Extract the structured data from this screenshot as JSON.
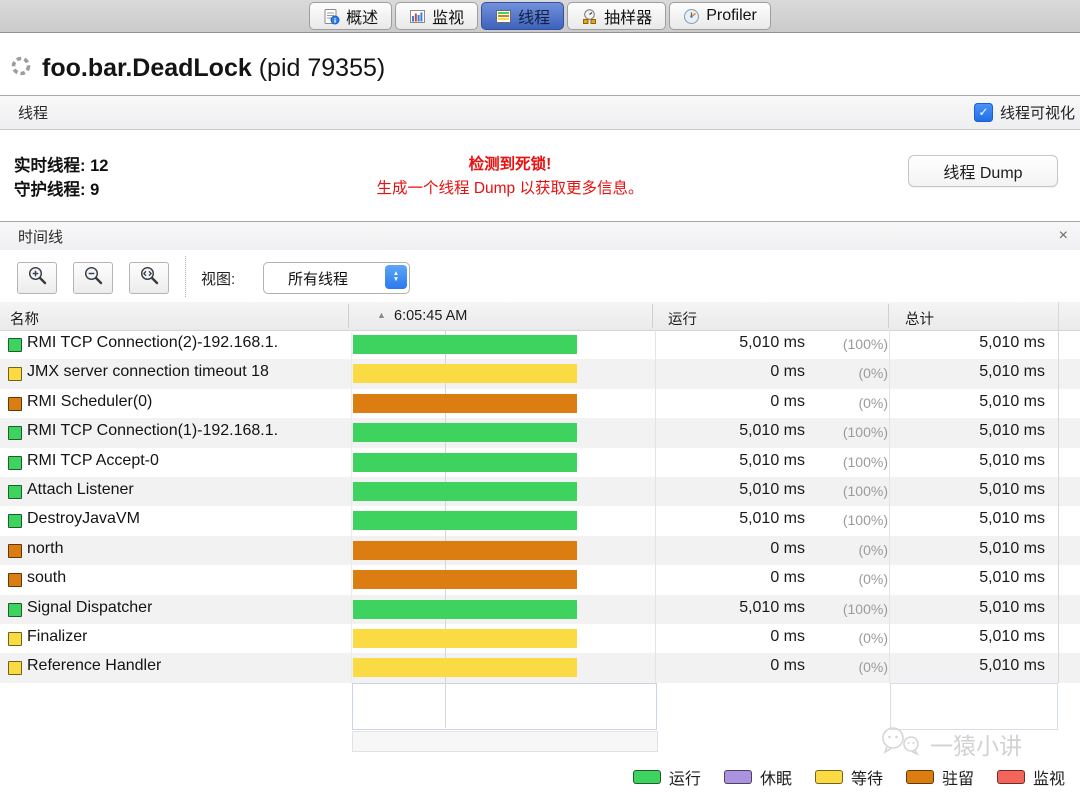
{
  "colors": {
    "running": "#3dd35e",
    "waiting": "#fadb44",
    "parked": "#dc7d12",
    "sleeping": "#ac93df",
    "monitor": "#f3655a",
    "accent_blue": "#2e7ef0",
    "warning_red": "#ea1010",
    "selected_tab_blue": "#4a70c8"
  },
  "tabs": [
    {
      "label": "概述"
    },
    {
      "label": "监视"
    },
    {
      "label": "线程",
      "active": true
    },
    {
      "label": "抽样器"
    },
    {
      "label": "Profiler"
    }
  ],
  "title": {
    "app_name": "foo.bar.DeadLock",
    "pid": "(pid 79355)"
  },
  "threads_panel": {
    "title": "线程",
    "visualize_checkbox_label": "线程可视化",
    "checkbox_glyph": "✓",
    "live_threads_label": "实时线程:",
    "live_threads_value": "12",
    "daemon_threads_label": "守护线程:",
    "daemon_threads_value": "9",
    "deadlock_warning_line1": "检测到死锁!",
    "deadlock_warning_line2": "生成一个线程 Dump 以获取更多信息。",
    "thread_dump_button": "线程 Dump"
  },
  "timeline_panel": {
    "title": "时间线",
    "close_glyph": "×",
    "view_label": "视图:",
    "view_selected": "所有线程"
  },
  "table": {
    "name_header": "名称",
    "sort_indicator": "▲",
    "time_header": "6:05:45 AM",
    "running_header": "运行",
    "total_header": "总计",
    "rows": [
      {
        "name": "RMI TCP Connection(2)-192.168.1.",
        "state": "running",
        "running": "5,010 ms",
        "percent": "(100%)",
        "total": "5,010 ms"
      },
      {
        "name": "JMX server connection timeout 18",
        "state": "waiting",
        "running": "0 ms",
        "percent": "(0%)",
        "total": "5,010 ms"
      },
      {
        "name": "RMI Scheduler(0)",
        "state": "parked",
        "running": "0 ms",
        "percent": "(0%)",
        "total": "5,010 ms"
      },
      {
        "name": "RMI TCP Connection(1)-192.168.1.",
        "state": "running",
        "running": "5,010 ms",
        "percent": "(100%)",
        "total": "5,010 ms"
      },
      {
        "name": "RMI TCP Accept-0",
        "state": "running",
        "running": "5,010 ms",
        "percent": "(100%)",
        "total": "5,010 ms"
      },
      {
        "name": "Attach Listener",
        "state": "running",
        "running": "5,010 ms",
        "percent": "(100%)",
        "total": "5,010 ms"
      },
      {
        "name": "DestroyJavaVM",
        "state": "running",
        "running": "5,010 ms",
        "percent": "(100%)",
        "total": "5,010 ms"
      },
      {
        "name": "north",
        "state": "parked",
        "running": "0 ms",
        "percent": "(0%)",
        "total": "5,010 ms"
      },
      {
        "name": "south",
        "state": "parked",
        "running": "0 ms",
        "percent": "(0%)",
        "total": "5,010 ms"
      },
      {
        "name": "Signal Dispatcher",
        "state": "running",
        "running": "5,010 ms",
        "percent": "(100%)",
        "total": "5,010 ms"
      },
      {
        "name": "Finalizer",
        "state": "waiting",
        "running": "0 ms",
        "percent": "(0%)",
        "total": "5,010 ms"
      },
      {
        "name": "Reference Handler",
        "state": "waiting",
        "running": "0 ms",
        "percent": "(0%)",
        "total": "5,010 ms"
      }
    ]
  },
  "legend": [
    {
      "label": "运行",
      "state": "running"
    },
    {
      "label": "休眠",
      "state": "sleeping"
    },
    {
      "label": "等待",
      "state": "waiting"
    },
    {
      "label": "驻留",
      "state": "parked"
    },
    {
      "label": "监视",
      "state": "monitor"
    }
  ],
  "watermark": "一猿小讲"
}
